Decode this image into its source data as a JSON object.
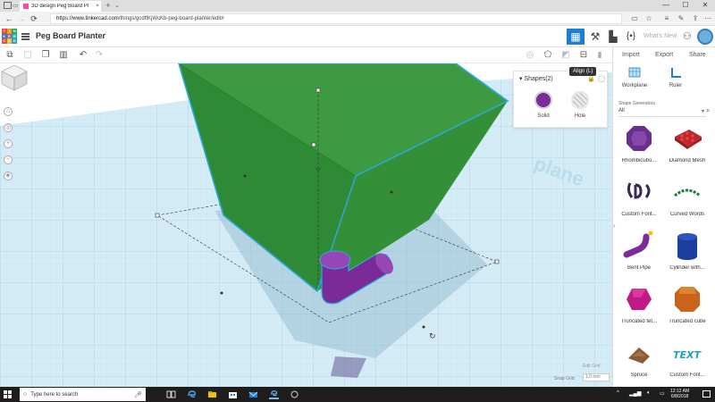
{
  "browser": {
    "tab_title": "3D design Peg Board Pl",
    "tab_close": "×",
    "tab_new": "+",
    "tab_more": "⌄",
    "url_host": "https://www.tinkercad.com",
    "url_path": "/things/gcdftKjWcKb-peg-board-planter/edit#",
    "window_controls": [
      "—",
      "☐",
      "✕"
    ],
    "nav": {
      "back": "←",
      "forward": "→",
      "refresh": "⟳",
      "home": "⌂"
    }
  },
  "app": {
    "logo_letters": [
      "TIN",
      "KER",
      "CAD"
    ],
    "logo_colors": [
      "#e84b3c",
      "#f39c12",
      "#27ae60",
      "#2980b9",
      "#9b59b6",
      "#1abc9c",
      "#e74c3c",
      "#f1c40f",
      "#3498db"
    ],
    "doc_title": "Peg Board Planter",
    "whats_new": "What's New"
  },
  "toolbar": {
    "undo": "↶",
    "redo": "↷",
    "delete": "🗑"
  },
  "inspector": {
    "title": "Shapes(2)",
    "solid_label": "Solid",
    "hole_label": "Hole",
    "tooltip": "Align (L)",
    "solid_color": "#7a2a99"
  },
  "workspace": {
    "workplane_text": "plane",
    "edit_grid": "Edit Grid",
    "snap_grid_label": "Snap Grid",
    "snap_grid_value": "1.0 mm",
    "box_color": "#3f9c3f",
    "highlight_color": "#2ea8e0"
  },
  "right_panel": {
    "actions": [
      "Import",
      "Export",
      "Share"
    ],
    "tools": [
      "Workplane",
      "Ruler"
    ],
    "generators_label": "Shape Generators",
    "category": "All",
    "shapes": [
      {
        "label": "Rhombicubo...",
        "icon": "rhombicuboctahedron-icon"
      },
      {
        "label": "Diamond Mesh",
        "icon": "diamond-mesh-icon"
      },
      {
        "label": "Custom Font...",
        "icon": "custom-font-icon"
      },
      {
        "label": "Curved Words",
        "icon": "curved-words-icon"
      },
      {
        "label": "Bent Pipe",
        "icon": "bent-pipe-icon"
      },
      {
        "label": "Cylinder with...",
        "icon": "cylinder-icon"
      },
      {
        "label": "Truncated tet...",
        "icon": "truncated-tetrahedron-icon"
      },
      {
        "label": "Truncated cube",
        "icon": "truncated-cube-icon"
      },
      {
        "label": "Spruce",
        "icon": "spruce-icon"
      },
      {
        "label": "Custom Font...",
        "icon": "custom-font-text-icon"
      }
    ]
  },
  "taskbar": {
    "search_placeholder": "Type here to search",
    "tray_lang": "^",
    "time": "12:12 AM",
    "date": "6/8/2018"
  }
}
